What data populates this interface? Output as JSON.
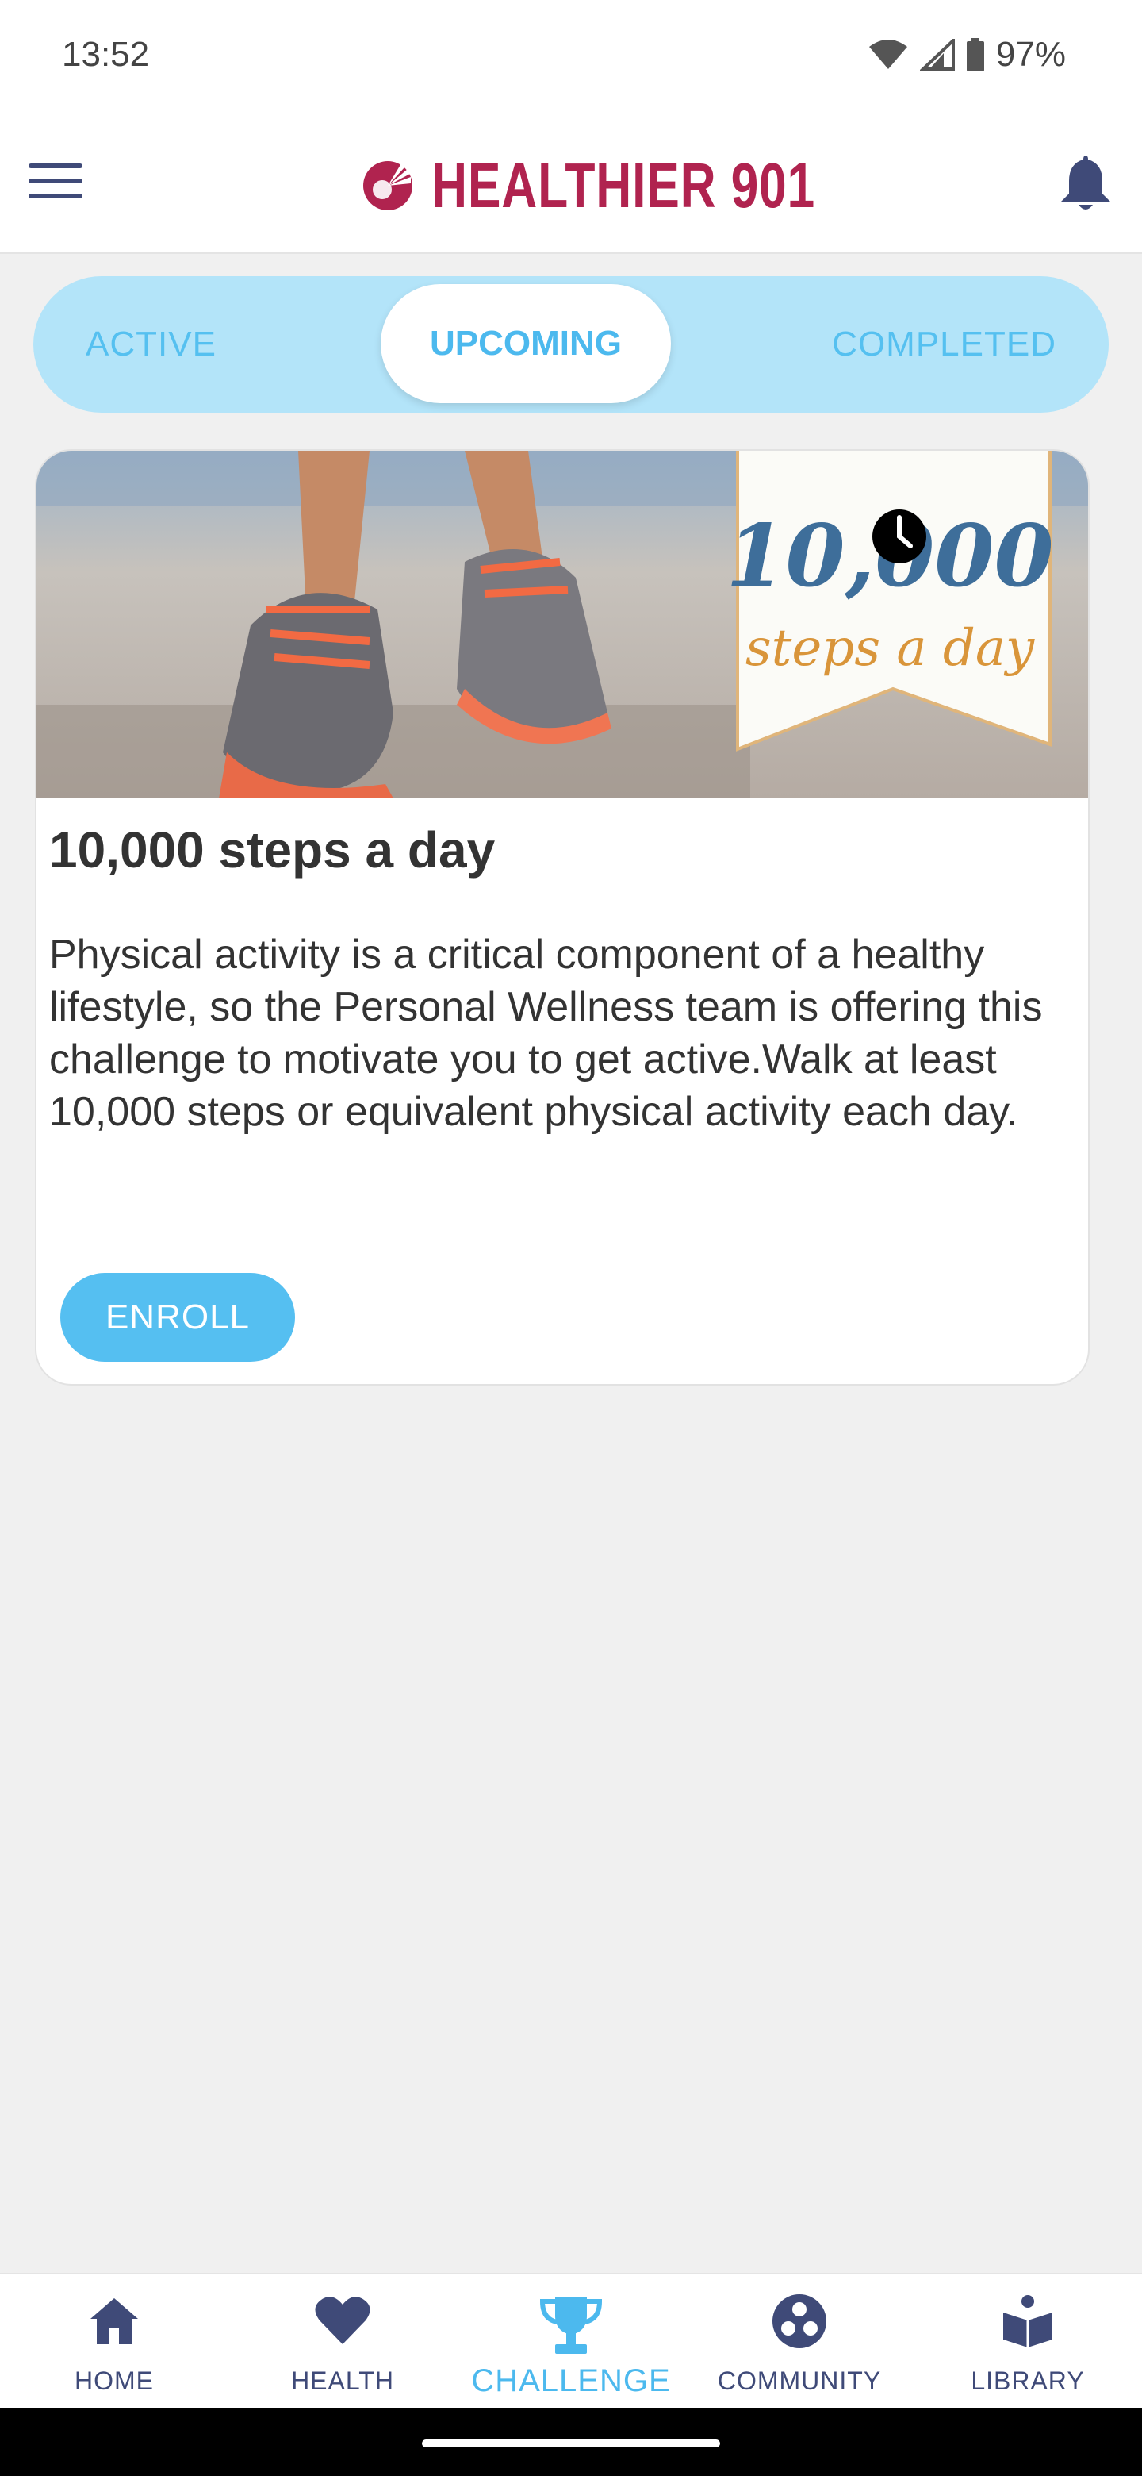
{
  "status_bar": {
    "time": "13:52",
    "battery": "97%"
  },
  "header": {
    "brand": "HEALTHIER 901",
    "brand_color": "#b0234f"
  },
  "tabs": {
    "active_label": "ACTIVE",
    "upcoming_label": "UPCOMING",
    "completed_label": "COMPLETED",
    "selected": "UPCOMING"
  },
  "card": {
    "image_text_number": "10,000",
    "image_text_tagline": "steps a day",
    "title": "10,000 steps a day",
    "description": "Physical activity is a critical component of a healthy lifestyle, so the Personal Wellness team is offering this challenge to motivate you to get active.Walk at least 10,000 steps or equivalent physical activity each day.",
    "enroll_label": "ENROLL"
  },
  "bottom_nav": {
    "items": [
      {
        "label": "HOME",
        "icon": "home-icon"
      },
      {
        "label": "HEALTH",
        "icon": "heart-icon"
      },
      {
        "label": "CHALLENGE",
        "icon": "trophy-icon"
      },
      {
        "label": "COMMUNITY",
        "icon": "community-icon"
      },
      {
        "label": "LIBRARY",
        "icon": "library-icon"
      }
    ],
    "active": "CHALLENGE"
  },
  "colors": {
    "accent": "#55bff1",
    "tab_track": "#b3e4f9",
    "nav_icon": "#3f4a78",
    "background": "#f0f0f0"
  }
}
